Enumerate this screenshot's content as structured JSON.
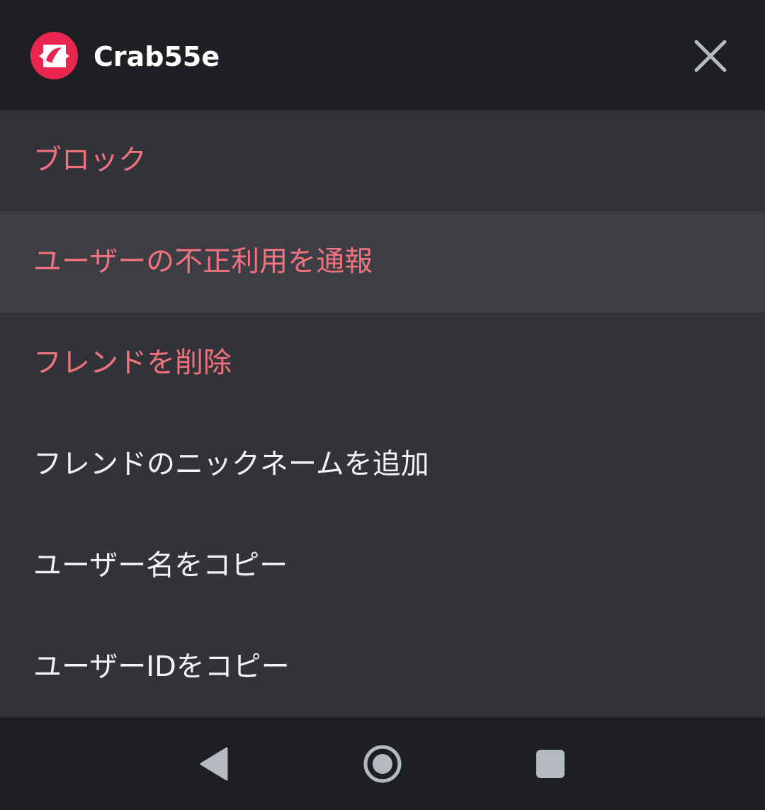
{
  "header": {
    "username": "Crab55e",
    "avatar_icon": "crab-logo-icon",
    "avatar_color": "#e8254f",
    "close_icon": "close-icon"
  },
  "menu": {
    "items": [
      {
        "label": "ブロック",
        "style": "danger"
      },
      {
        "label": "ユーザーの不正利用を通報",
        "style": "danger",
        "pressed": true
      },
      {
        "label": "フレンドを削除",
        "style": "danger"
      },
      {
        "label": "フレンドのニックネームを追加",
        "style": "normal"
      },
      {
        "label": "ユーザー名をコピー",
        "style": "normal"
      },
      {
        "label": "ユーザーIDをコピー",
        "style": "normal"
      }
    ]
  },
  "navbar": {
    "back_icon": "back-triangle-icon",
    "home_icon": "home-circle-icon",
    "recents_icon": "recents-square-icon"
  },
  "colors": {
    "danger": "#f0727e",
    "text": "#f2f3f5",
    "sheet_bg": "#313338",
    "header_bg": "#1e1f22",
    "pressed_bg": "#3c3e44"
  }
}
